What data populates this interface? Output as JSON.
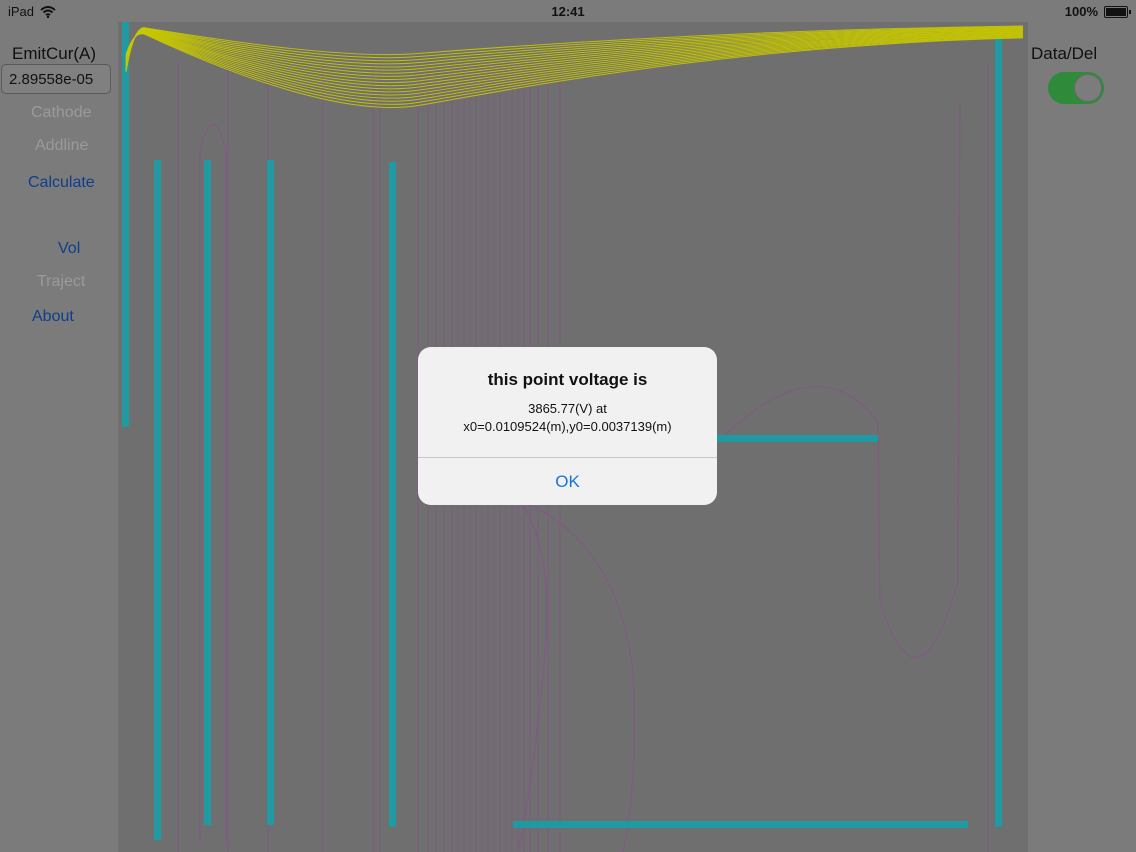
{
  "status_bar": {
    "device": "iPad",
    "time": "12:41",
    "battery": "100%"
  },
  "sidebar": {
    "emit_label": "EmitCur(A)",
    "emit_value": "2.89558e-05",
    "buttons": {
      "cathode": "Cathode",
      "addline": "Addline",
      "calculate": "Calculate",
      "vol": "Vol",
      "traject": "Traject",
      "about": "About"
    }
  },
  "right_panel": {
    "datadel_label": "Data/Del",
    "datadel_on": true
  },
  "alert": {
    "title": "this point voltage is",
    "line1": "3865.77(V) at",
    "line2": "x0=0.0109524(m),y0=0.0037139(m)",
    "ok_label": "OK"
  },
  "colors": {
    "electrode": "#1f9aa2",
    "trajectory": "#c8c800",
    "equipotential": "#8a4f8e",
    "accent": "#1a73d9",
    "toggle_on": "#2f8a3a"
  }
}
